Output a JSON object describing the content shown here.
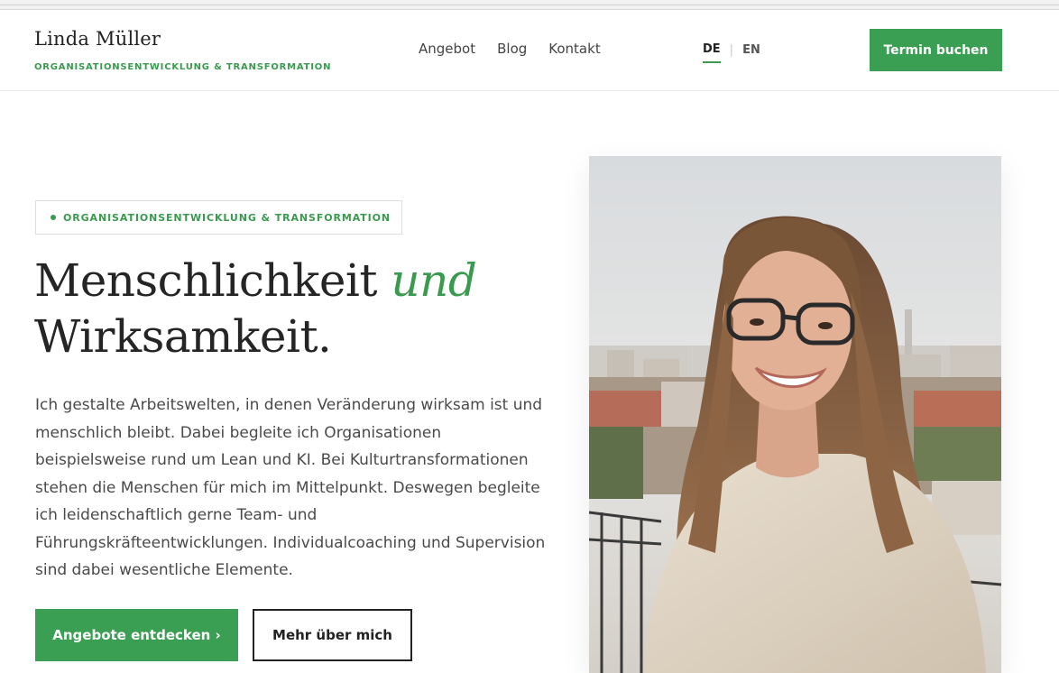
{
  "header": {
    "brand_name": "Linda Müller",
    "brand_tagline": "ORGANISATIONSENTWICKLUNG & TRANSFORMATION",
    "nav": [
      {
        "label": "Angebot"
      },
      {
        "label": "Blog"
      },
      {
        "label": "Kontakt"
      }
    ],
    "lang": {
      "active": "DE",
      "separator": "|",
      "other": "EN"
    },
    "cta_label": "Termin buchen"
  },
  "hero": {
    "badge": "ORGANISATIONSENTWICKLUNG & TRANSFORMATION",
    "title_part1": "Menschlichkeit",
    "title_accent": "und",
    "title_part2": "Wirksamkeit.",
    "paragraph": "Ich gestalte Arbeitswelten, in denen Veränderung wirksam ist und menschlich bleibt. Dabei begleite ich Organisationen beispielsweise rund um Lean und KI. Bei Kulturtransformationen stehen die Menschen für mich im Mittelpunkt. Deswegen begleite ich leidenschaftlich gerne Team- und Führungskräfteentwicklungen. Individualcoaching und Supervision sind dabei wesentliche Elemente.",
    "primary_button": "Angebote entdecken ›",
    "secondary_button": "Mehr über mich"
  },
  "colors": {
    "accent_green": "#3a9f52",
    "text_dark": "#252525"
  }
}
